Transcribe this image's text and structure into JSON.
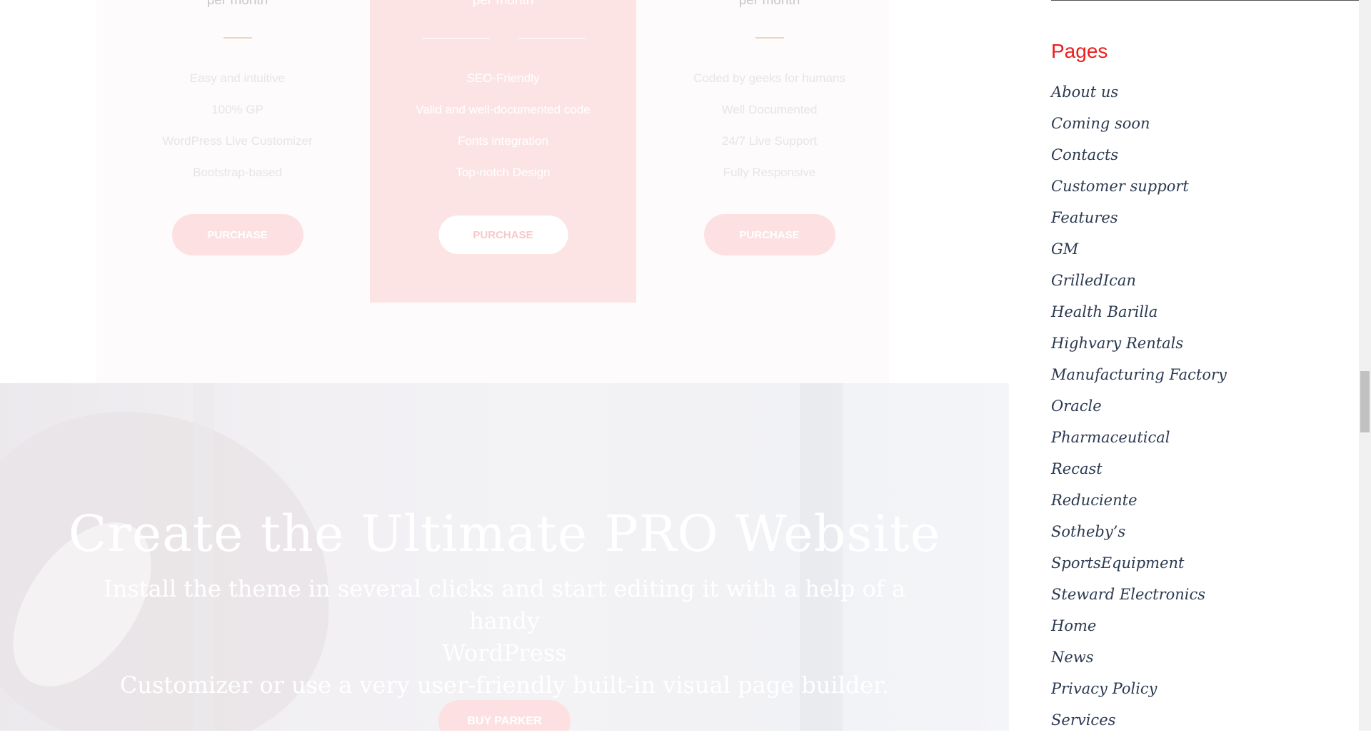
{
  "pricing": {
    "plans": [
      {
        "period": "per month",
        "features": [
          "Easy and intuitive",
          "100% GP",
          "WordPress Live Customizer",
          "Bootstrap-based"
        ],
        "button": "PURCHASE"
      },
      {
        "period": "per month",
        "features": [
          "SEO-Friendly",
          "Valid and well-documented code",
          "Fonts integration",
          "Top-notch Design"
        ],
        "button": "PURCHASE"
      },
      {
        "period": "per month",
        "features": [
          "Coded by geeks for humans",
          "Well Documented",
          "24/7 Live Support",
          "Fully Responsive"
        ],
        "button": "PURCHASE"
      }
    ]
  },
  "hero": {
    "title": "Create the Ultimate PRO Website",
    "subtitle_line1": "Install the theme in several clicks and start editing it with a help of a handy",
    "subtitle_line2": "WordPress",
    "subtitle_line3": "Customizer or use a very user-friendly built-in visual page builder.",
    "button": "BUY PARKER"
  },
  "sidebar": {
    "title": "Pages",
    "pages": [
      "About us",
      "Coming soon",
      "Contacts",
      "Customer support",
      "Features",
      "GM",
      "GrilledIcan",
      "Health Barilla",
      "Highvary Rentals",
      "Manufacturing Factory",
      "Oracle",
      "Pharmaceutical",
      "Recast",
      "Reduciente",
      "Sotheby’s",
      "SportsEquipment",
      "Steward Electronics",
      "Home",
      "News",
      "Privacy Policy",
      "Services"
    ]
  },
  "colors": {
    "accent": "#ee1c1c",
    "featured_plan_bg": "#fde4e4",
    "button_pink": "#fde1e2",
    "link_text": "#2b3950"
  }
}
